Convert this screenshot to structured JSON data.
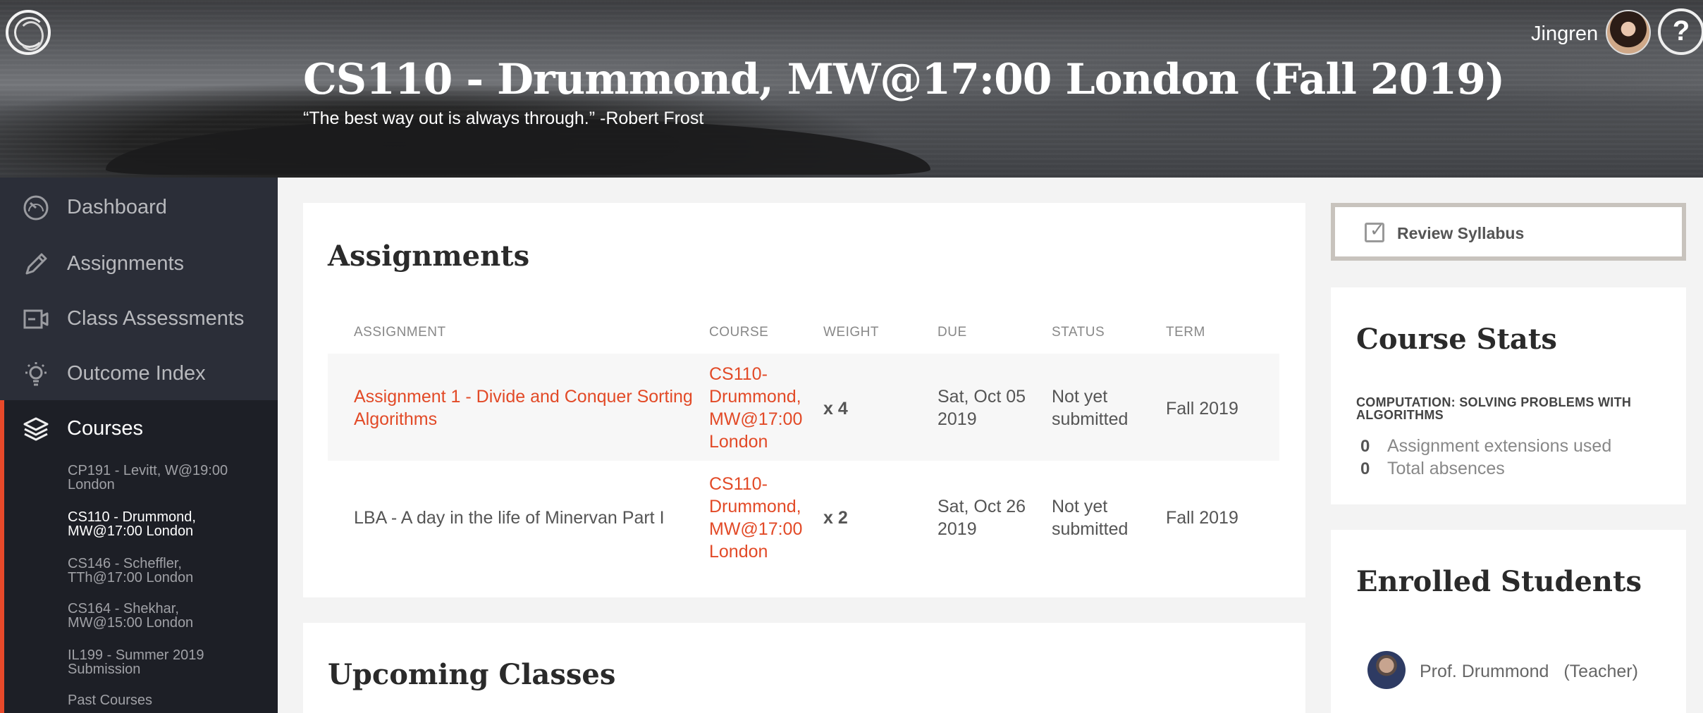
{
  "header": {
    "course_title": "CS110 - Drummond, MW@17:00 London (Fall 2019)",
    "quote": "“The best way out is always through.” -Robert Frost",
    "user_name": "Jingren",
    "help_label": "?"
  },
  "sidebar": {
    "items": [
      {
        "label": "Dashboard",
        "icon": "dashboard-gauge-icon"
      },
      {
        "label": "Assignments",
        "icon": "pencil-icon"
      },
      {
        "label": "Class Assessments",
        "icon": "assessment-icon"
      },
      {
        "label": "Outcome Index",
        "icon": "lightbulb-icon"
      },
      {
        "label": "Courses",
        "icon": "layers-icon"
      }
    ],
    "sub_courses": [
      "CP191 - Levitt, W@19:00 London",
      "CS110 - Drummond, MW@17:00 London",
      "CS146 - Scheffler, TTh@17:00 London",
      "CS164 - Shekhar, MW@15:00 London",
      "IL199 - Summer 2019 Submission",
      "Past Courses"
    ]
  },
  "assignments": {
    "title": "Assignments",
    "columns": [
      "ASSIGNMENT",
      "COURSE",
      "WEIGHT",
      "DUE",
      "STATUS",
      "TERM"
    ],
    "rows": [
      {
        "assignment": "Assignment 1 - Divide and Conquer Sorting Algorithms",
        "course": "CS110-Drummond, MW@17:00 London",
        "weight": "x 4",
        "due": "Sat, Oct 05 2019",
        "status": "Not yet submitted",
        "term": "Fall 2019"
      },
      {
        "assignment": "LBA - A day in the life of Minervan Part I",
        "course": "CS110-Drummond, MW@17:00 London",
        "weight": "x 2",
        "due": "Sat, Oct 26 2019",
        "status": "Not yet submitted",
        "term": "Fall 2019"
      }
    ]
  },
  "upcoming": {
    "title": "Upcoming Classes"
  },
  "syllabus": {
    "label": "Review Syllabus"
  },
  "stats": {
    "title": "Course Stats",
    "subject": "COMPUTATION: SOLVING PROBLEMS WITH ALGORITHMS",
    "extensions_count": "0",
    "extensions_label": "Assignment extensions used",
    "absences_count": "0",
    "absences_label": "Total absences"
  },
  "enrolled": {
    "title": "Enrolled Students",
    "teacher_name": "Prof. Drummond",
    "teacher_role": "(Teacher)"
  },
  "colors": {
    "accent": "#e24a27",
    "sidebar": "#2b2e38",
    "sidebar_active": "#1d1f26"
  }
}
